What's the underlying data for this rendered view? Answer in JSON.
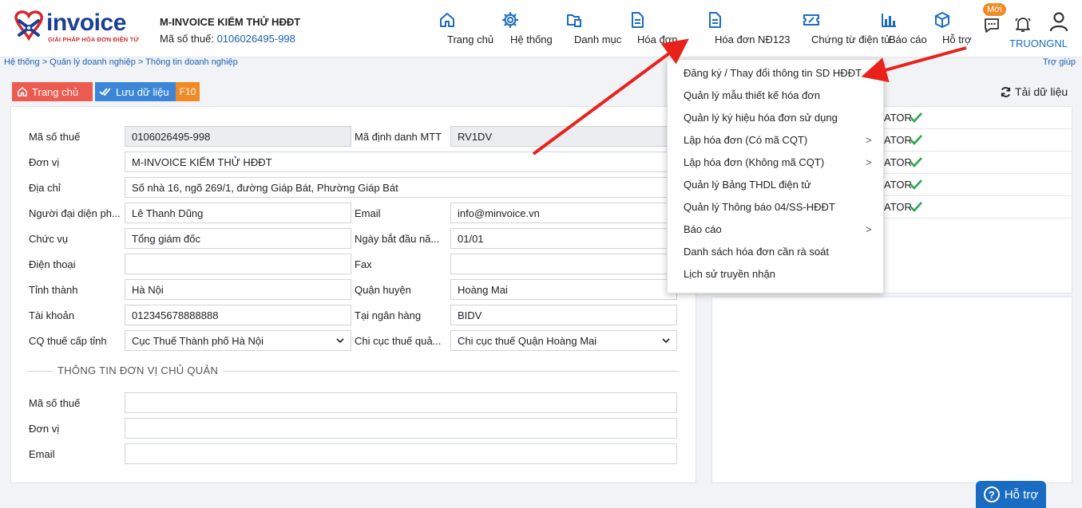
{
  "header": {
    "logo_text": "invoice",
    "logo_sub": "GIẢI PHÁP HÓA ĐƠN ĐIỆN TỬ",
    "company_name": "M-INVOICE KIỂM THỬ HĐĐT",
    "tax_label": "Mã số thuế:",
    "tax_value": "0106026495-998",
    "nav": [
      {
        "label": "Trang chủ",
        "icon": "home-icon"
      },
      {
        "label": "Hệ thống",
        "icon": "gear-icon"
      },
      {
        "label": "Danh mục",
        "icon": "folder-icon"
      },
      {
        "label": "Hóa đơn",
        "icon": "document-icon"
      },
      {
        "label": "Hóa đơn NĐ123",
        "icon": "document-icon"
      },
      {
        "label": "Chứng từ điện tử",
        "icon": "ticket-icon"
      },
      {
        "label": "Báo cáo",
        "icon": "bar-chart-icon"
      },
      {
        "label": "Hỗ trợ",
        "icon": "cube-icon"
      }
    ],
    "new_badge": "Mới",
    "username": "TRUONGNL"
  },
  "breadcrumb": "Hệ thống > Quản lý doanh nghiệp > Thông tin doanh nghiệp",
  "help_link": "Trợ giúp",
  "toolbar": {
    "home_label": "Trang chủ",
    "save_label": "Lưu dữ liệu",
    "save_key": "F10",
    "reload_label": "Tải dữ liệu"
  },
  "form": {
    "tax_code_label": "Mã số thuế",
    "tax_code": "0106026495-998",
    "mtt_label": "Mã định danh MTT",
    "mtt": "RV1DV",
    "unit_label": "Đơn vị",
    "unit": "M-INVOICE KIỂM THỬ HĐĐT",
    "address_label": "Địa chỉ",
    "address": "Số nhà 16, ngõ 269/1, đường Giáp Bát, Phường Giáp Bát",
    "rep_label": "Người đại diện ph...",
    "rep": "Lê Thanh Dũng",
    "email_label": "Email",
    "email": "info@minvoice.vn",
    "position_label": "Chức vụ",
    "position": "Tổng giám đốc",
    "start_label": "Ngày bắt đầu nă...",
    "start": "01/01",
    "phone_label": "Điện thoại",
    "phone": "",
    "fax_label": "Fax",
    "fax": "",
    "province_label": "Tỉnh thành",
    "province": "Hà Nội",
    "district_label": "Quận huyện",
    "district": "Hoàng Mai",
    "account_label": "Tài khoản",
    "account": "012345678888888",
    "bank_label": "Tại ngân hàng",
    "bank": "BIDV",
    "cqt_label": "CQ thuế cấp tỉnh",
    "cqt": "Cục Thuế Thành phố Hà Nội",
    "cct_label": "Chi cục thuế quả...",
    "cct": "Chi cục thuế Quận Hoàng Mai",
    "section_title": "THÔNG TIN ĐƠN VỊ CHỦ QUẢN",
    "parent_tax_label": "Mã số thuế",
    "parent_tax": "",
    "parent_unit_label": "Đơn vị",
    "parent_unit": "",
    "parent_email_label": "Email",
    "parent_email": ""
  },
  "right_rows": [
    "ATOR",
    "ATOR",
    "ATOR",
    "ATOR",
    "ATOR"
  ],
  "dropdown": [
    {
      "label": "Đăng ký / Thay đổi thông tin SD HĐĐT",
      "arrow": ""
    },
    {
      "label": "Quản lý mẫu thiết kế hóa đơn",
      "arrow": ""
    },
    {
      "label": "Quản lý ký hiệu hóa đơn sử dụng",
      "arrow": ""
    },
    {
      "label": "Lập hóa đơn (Có mã CQT)",
      "arrow": ">"
    },
    {
      "label": "Lập hóa đơn (Không mã CQT)",
      "arrow": ">"
    },
    {
      "label": "Quản lý Bảng THDL điện tử",
      "arrow": ""
    },
    {
      "label": "Quản lý Thông báo 04/SS-HĐĐT",
      "arrow": ""
    },
    {
      "label": "Báo cáo",
      "arrow": ">"
    },
    {
      "label": "Danh sách hóa đơn cần rà soát",
      "arrow": ""
    },
    {
      "label": "Lịch sử truyền nhận",
      "arrow": ""
    }
  ],
  "support_button": "Hỗ trợ",
  "colors": {
    "primary": "#1a6cc2",
    "active": "#d7262b",
    "save": "#3b86d6",
    "home": "#ec5b4f",
    "key": "#f08a24",
    "annotation": "#e8221b"
  }
}
